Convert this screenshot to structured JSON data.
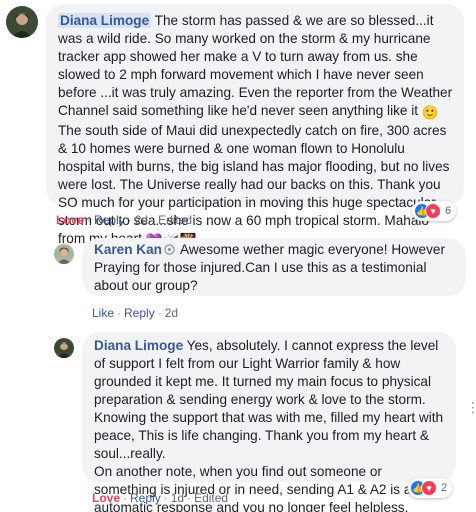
{
  "comments": [
    {
      "author": "Diana Limoge",
      "text": "The storm has passed & we are so blessed...it was a wild ride. So many worked on the storm & my hurricane tracker app showed her make a V to turn away from us. she slowed to 2 mph forward movement which I have never seen before ...it was truly amazing. Even the reporter from the Weather Channel said something like he'd never seen anything like it",
      "text2": "The south side of Maui did unexpectedly catch on fire, 300 acres & 10 homes were burned & one woman flown to Honolulu hospital with burns, the big island has major flooding, but no lives were lost. The Universe really had our backs on this. Thank you SO much for your participation in moving this huge spectacular storm out to sea...she is now a 60 mph tropical storm. Mahalo from my heart",
      "emoji_smile": "🙂",
      "emoji_trail": "💜🦋🎇",
      "actions": {
        "love": "Love",
        "reply": "Reply",
        "time": "2d",
        "edited": "Edited"
      },
      "reaction_count": "6"
    },
    {
      "author": "Karen Kan",
      "text": "Awesome wether magic everyone! However Praying for those injured.Can I use this as a testimonial about our group?",
      "actions": {
        "like": "Like",
        "reply": "Reply",
        "time": "2d"
      }
    },
    {
      "author": "Diana Limoge",
      "text": "Yes, absolutely. I cannot express the level of support I felt from our Light Warrior family & how grounded it kept me. It turned my main focus to physical preparation & sending energy work & love to the storm. Knowing the support that was with me, filled my heart with peace, This is life changing. Thank you from my heart & soul...really.",
      "text2": "On another note, when you find out someone or something is injured or in need, sending A1 & A2 is an automatic response and you no longer feel helpless.",
      "actions": {
        "love": "Love",
        "reply": "Reply",
        "time": "1d",
        "edited": "Edited"
      },
      "reaction_count": "2"
    }
  ],
  "colors": {
    "link": "#385898",
    "love": "#f33e58",
    "bubble": "#f2f3f5",
    "meta": "#606770"
  },
  "icons": {
    "more": "more-options-icon",
    "admin": "admin-badge-icon",
    "like": "like-reaction-icon",
    "love": "love-reaction-icon"
  }
}
